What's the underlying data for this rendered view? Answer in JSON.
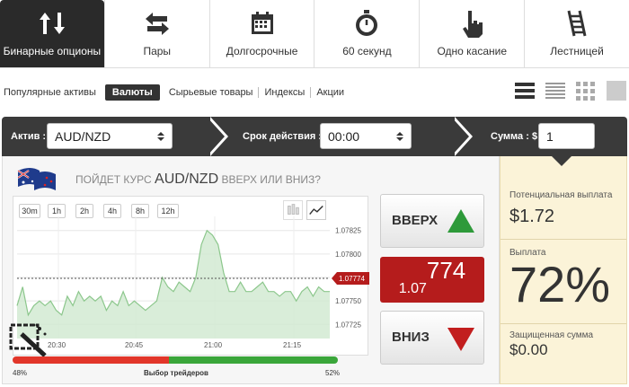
{
  "tabs": [
    {
      "label": "Бинарные опционы",
      "icon": "arrows-updown-icon",
      "active": true
    },
    {
      "label": "Пары",
      "icon": "arrows-leftright-icon"
    },
    {
      "label": "Долгосрочные",
      "icon": "calendar-icon"
    },
    {
      "label": "60 секунд",
      "icon": "stopwatch-icon"
    },
    {
      "label": "Одно касание",
      "icon": "hand-pointer-icon"
    },
    {
      "label": "Лестницей",
      "icon": "ladder-icon"
    }
  ],
  "subnav": [
    "Популярные активы",
    "Валюты",
    "Сырьевые товары",
    "Индексы",
    "Акции"
  ],
  "bar": {
    "asset_label": "Актив :",
    "asset_value": "AUD/NZD",
    "expiry_label": "Срок действия :",
    "expiry_value": "00:00",
    "amount_label": "Сумма : $",
    "amount_value": "1"
  },
  "question": {
    "prefix": "ПОЙДЕТ КУРС",
    "pair": "AUD/NZD",
    "suffix": "ВВЕРХ ИЛИ ВНИЗ?"
  },
  "timeframes": [
    "30m",
    "1h",
    "2h",
    "4h",
    "8h",
    "12h"
  ],
  "chart_data": {
    "type": "area",
    "x_ticks": [
      "20:30",
      "20:45",
      "21:00",
      "21:15"
    ],
    "y_ticks": [
      "1.07825",
      "1.07800",
      "1.07775",
      "1.07750",
      "1.07725"
    ],
    "ylim": [
      1.0771,
      1.0784
    ],
    "values": [
      1.07745,
      1.07765,
      1.07735,
      1.07745,
      1.0775,
      1.07745,
      1.0775,
      1.0774,
      1.07735,
      1.07755,
      1.07745,
      1.0776,
      1.0775,
      1.07755,
      1.0775,
      1.07755,
      1.0774,
      1.0775,
      1.07745,
      1.0776,
      1.07745,
      1.0775,
      1.07745,
      1.0774,
      1.07745,
      1.0775,
      1.07775,
      1.07765,
      1.0776,
      1.0777,
      1.07765,
      1.0776,
      1.07775,
      1.0781,
      1.07825,
      1.0782,
      1.0781,
      1.0778,
      1.0776,
      1.0776,
      1.0777,
      1.0776,
      1.0776,
      1.07765,
      1.0777,
      1.0776,
      1.0776,
      1.07755,
      1.0776,
      1.0776,
      1.0775,
      1.0776,
      1.07765,
      1.07755,
      1.07765,
      1.0776,
      1.0776
    ],
    "current": "1.07774",
    "fill": "#cfe9cf",
    "line": "#8cc78c"
  },
  "buttons": {
    "up": "ВВЕРХ",
    "down": "ВНИЗ"
  },
  "price": {
    "small": "1.07",
    "big": "774"
  },
  "right": {
    "potential_label": "Потенциальная выплата",
    "potential_value": "$1.72",
    "payout_label": "Выплата",
    "payout_value": "72%",
    "protected_label": "Защищенная сумма",
    "protected_value": "$0.00"
  },
  "sentiment": {
    "left": "48%",
    "right": "52%",
    "label": "Выбор трейдеров",
    "left_frac": 0.48
  }
}
